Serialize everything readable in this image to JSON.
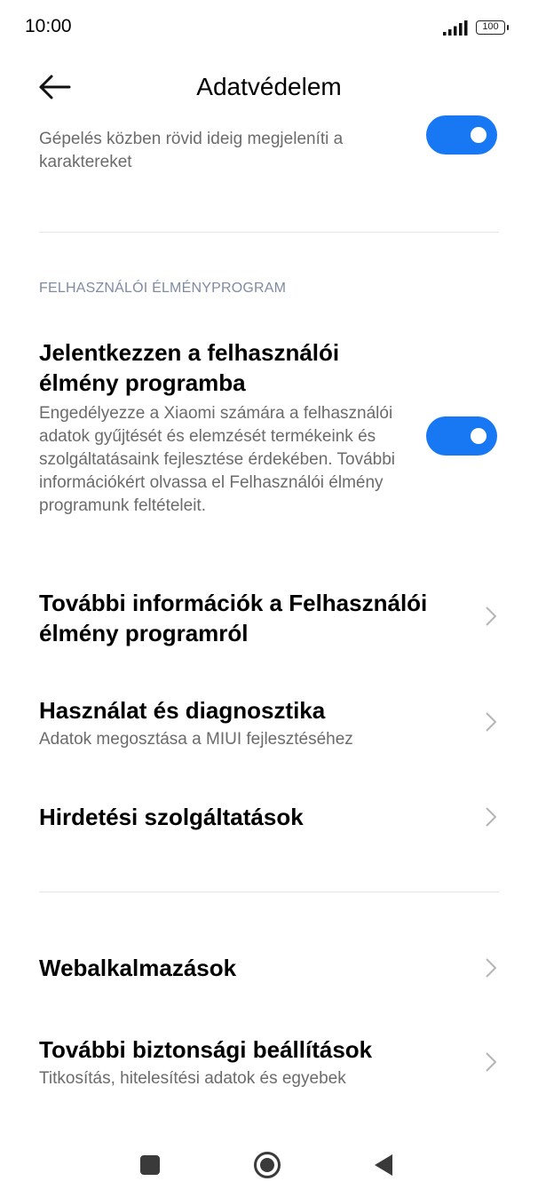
{
  "status_bar": {
    "time": "10:00",
    "battery": "100"
  },
  "header": {
    "title": "Adatvédelem"
  },
  "show_chars": {
    "subtitle": "Gépelés közben rövid ideig megjeleníti a karaktereket",
    "toggle_on": true
  },
  "section": {
    "label": "FELHASZNÁLÓI ÉLMÉNYPROGRAM"
  },
  "ux_program": {
    "title": "Jelentkezzen a felhasználói élmény programba",
    "subtitle": "Engedélyezze a Xiaomi számára a felhasználói adatok gyűjtését és elemzését termékeink és szolgáltatásaink fejlesztése érdekében. További információkért olvassa el Felhasználói élmény programunk feltételeit.",
    "toggle_on": true
  },
  "items": [
    {
      "title": "További információk a Felhasználói élmény programról",
      "subtitle": ""
    },
    {
      "title": "Használat és diagnosztika",
      "subtitle": "Adatok megosztása a MIUI fejlesztéséhez"
    },
    {
      "title": "Hirdetési szolgáltatások",
      "subtitle": ""
    },
    {
      "title": "Webalkalmazások",
      "subtitle": ""
    },
    {
      "title": "További biztonsági beállítások",
      "subtitle": "Titkosítás, hitelesítési adatok és egyebek"
    }
  ],
  "icons": {
    "back": "arrow-left-icon",
    "chevron": "chevron-right-icon",
    "recents": "square-icon",
    "home": "circle-icon",
    "nav_back": "triangle-left-icon"
  },
  "colors": {
    "accent": "#1877f2",
    "section_header": "#7f8ba3"
  }
}
